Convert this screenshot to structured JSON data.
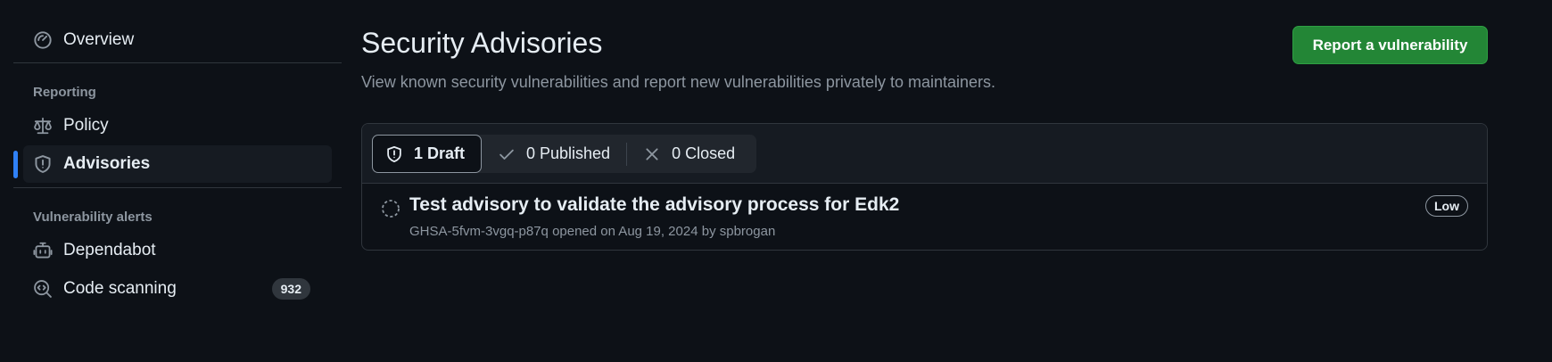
{
  "sidebar": {
    "overview": {
      "label": "Overview",
      "icon": "meter-icon"
    },
    "reporting_section": "Reporting",
    "policy": {
      "label": "Policy",
      "icon": "law-icon"
    },
    "advisories": {
      "label": "Advisories",
      "icon": "shield-icon",
      "active": true
    },
    "vulnerability_section": "Vulnerability alerts",
    "dependabot": {
      "label": "Dependabot",
      "icon": "dependabot-icon"
    },
    "code_scanning": {
      "label": "Code scanning",
      "icon": "codescan-icon",
      "count": "932"
    }
  },
  "header": {
    "title": "Security Advisories",
    "subtitle": "View known security vulnerabilities and report new vulnerabilities privately to maintainers.",
    "report_button": "Report a vulnerability"
  },
  "filters": [
    {
      "label": "1 Draft",
      "icon": "shield-icon",
      "selected": true
    },
    {
      "label": "0 Published",
      "icon": "check-icon",
      "selected": false
    },
    {
      "label": "0 Closed",
      "icon": "x-icon",
      "selected": false
    }
  ],
  "advisories": [
    {
      "title": "Test advisory to validate the advisory process for Edk2",
      "meta": "GHSA-5fvm-3vgq-p87q opened on Aug 19, 2024 by spbrogan",
      "severity": "Low",
      "status_icon": "draft-circle-icon"
    }
  ],
  "colors": {
    "background": "#0d1117",
    "accent": "#2f81f7",
    "button_green": "#238636",
    "muted_text": "#8d96a0"
  }
}
